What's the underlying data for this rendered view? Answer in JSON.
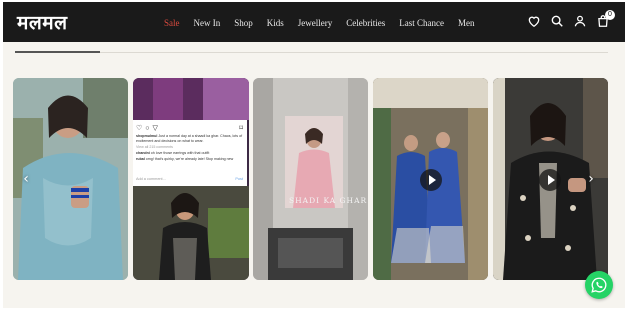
{
  "header": {
    "logo": "मलमल",
    "nav": [
      "Sale",
      "New In",
      "Shop",
      "Kids",
      "Jewellery",
      "Celebrities",
      "Last Chance",
      "Men"
    ],
    "cart_count": "0",
    "icons": [
      "heart-icon",
      "search-icon",
      "user-icon",
      "cart-icon"
    ]
  },
  "gallery": {
    "instagram_post": {
      "caption_user": "shopmulmul",
      "caption": "Just a normal day at a shaadi ka ghar. Chaos, lots of excitement and decisions on what to wear.",
      "view_comments": "View all 215 comments",
      "comment_1_user": "chandni",
      "comment_1": "oh love those earrings with that outfit",
      "comment_2_user": "rubal",
      "comment_2": "omg! that's quirky, we're already late! Stop making new",
      "add_comment": "Add a comment...",
      "post_label": "Post"
    },
    "overlay_text": "SHADI KA GHAR"
  },
  "colors": {
    "header_bg": "#1a1a1a",
    "sale": "#d94a3f",
    "page_bg": "#f6f4ef",
    "whatsapp": "#25d366"
  }
}
